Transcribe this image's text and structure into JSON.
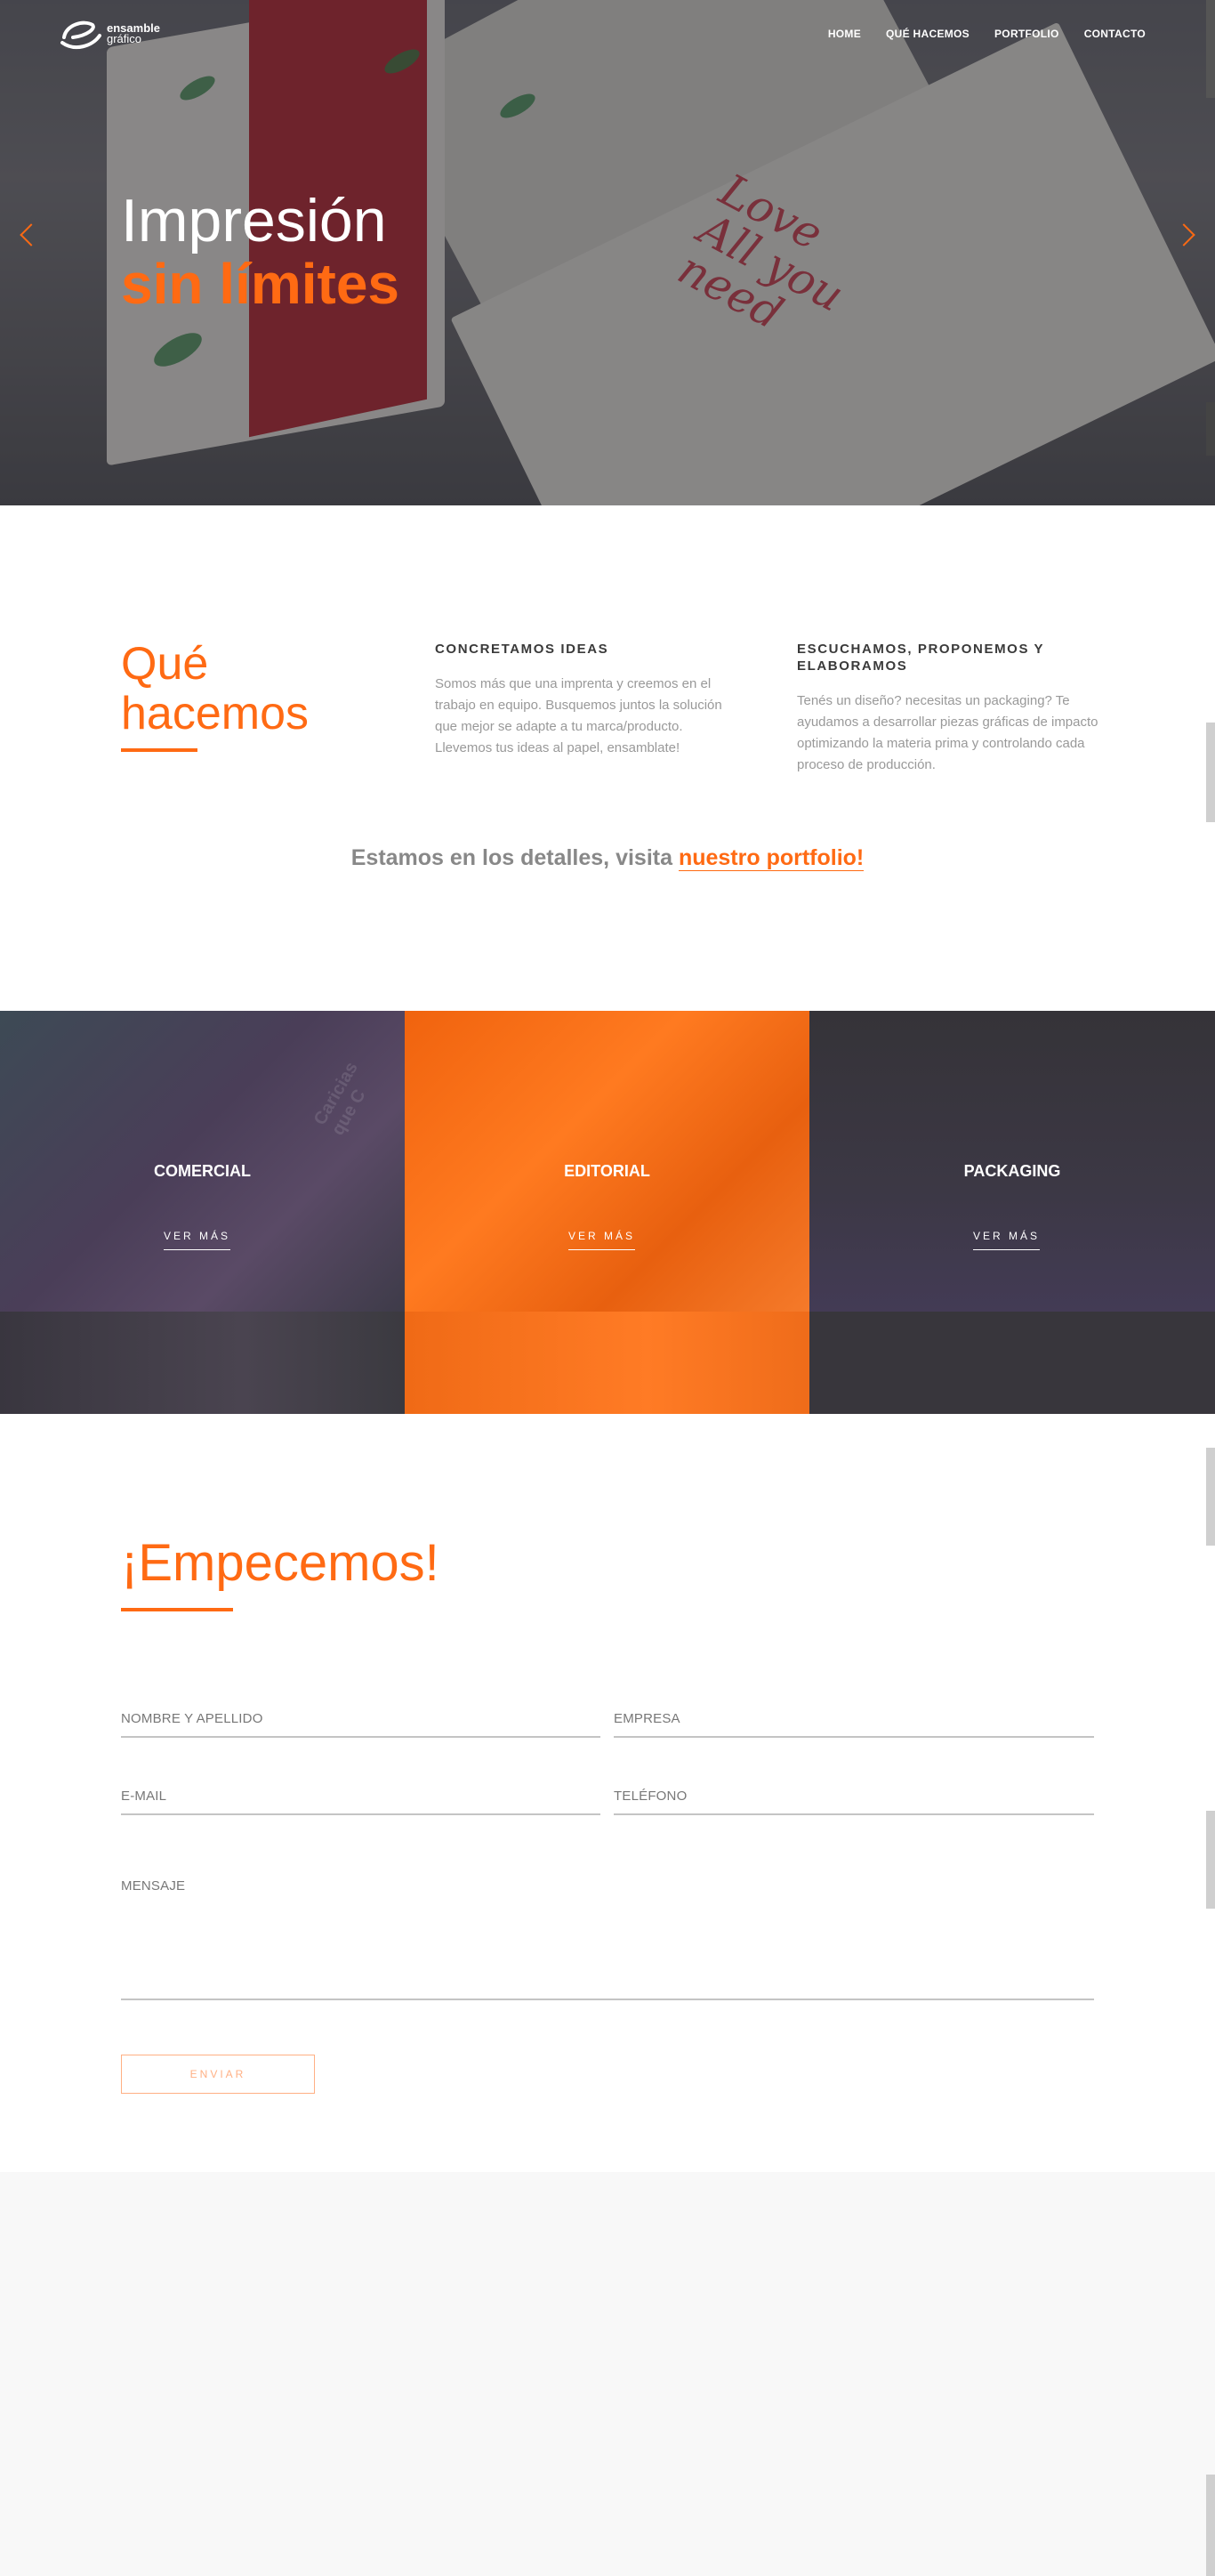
{
  "header": {
    "logo_line1": "ensamble",
    "logo_line2": "gráfico",
    "nav": [
      "HOME",
      "QUÉ HACEMOS",
      "PORTFOLIO",
      "CONTACTO"
    ]
  },
  "hero": {
    "title_line1": "Impresión",
    "title_line2": "sin límites"
  },
  "about": {
    "title_line1": "Qué",
    "title_line2": "hacemos",
    "columns": [
      {
        "heading": "CONCRETAMOS IDEAS",
        "text": "Somos más que una imprenta y creemos en el trabajo en equipo. Busquemos juntos la solución que mejor se adapte a tu marca/producto. Llevemos tus ideas al papel, ensamblate!"
      },
      {
        "heading": "ESCUCHAMOS, PROPONEMOS Y ELABORAMOS",
        "text": "Tenés un diseño? necesitas un packaging? Te ayudamos a desarrollar piezas gráficas de impacto optimizando la materia prima y controlando cada proceso de producción."
      }
    ],
    "portfolio_prefix": "Estamos en los detalles, visita ",
    "portfolio_link": "nuestro portfolio!"
  },
  "categories": [
    {
      "label": "COMERCIAL",
      "button": "VER MÁS"
    },
    {
      "label": "EDITORIAL",
      "button": "VER MÁS"
    },
    {
      "label": "PACKAGING",
      "button": "VER MÁS"
    }
  ],
  "contact": {
    "title": "¡Empecemos!",
    "placeholders": {
      "name": "NOMBRE Y APELLIDO",
      "company": "EMPRESA",
      "email": "E-MAIL",
      "phone": "TELÉFONO",
      "message": "MENSAJE"
    },
    "send_label": "ENVIAR"
  },
  "colors": {
    "accent": "#ff6a13",
    "dark": "#3a3a3a"
  }
}
